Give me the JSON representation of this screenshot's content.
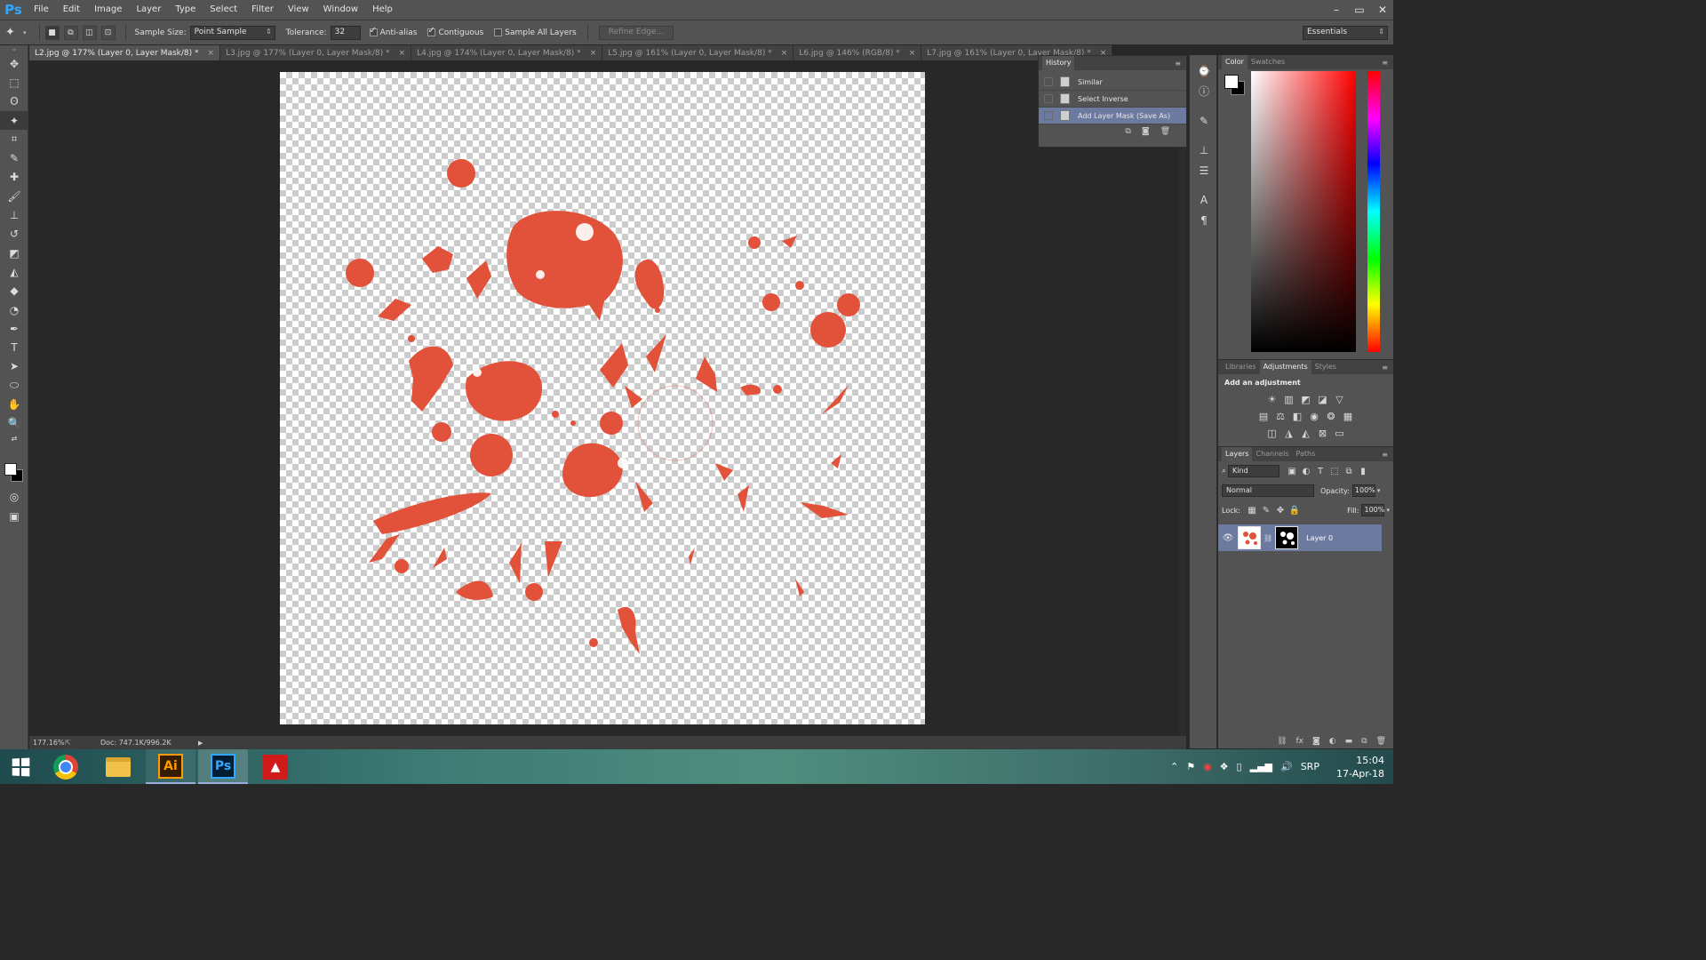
{
  "app": {
    "logo": "Ps"
  },
  "menu": [
    "File",
    "Edit",
    "Image",
    "Layer",
    "Type",
    "Select",
    "Filter",
    "View",
    "Window",
    "Help"
  ],
  "window_controls": {
    "minimize": "–",
    "restore": "▭",
    "close": "✕"
  },
  "options": {
    "sample_size_label": "Sample Size:",
    "sample_size_value": "Point Sample",
    "tolerance_label": "Tolerance:",
    "tolerance_value": "32",
    "anti_alias": "Anti-alias",
    "contiguous": "Contiguous",
    "sample_all_layers": "Sample All Layers",
    "refine_edge": "Refine Edge...",
    "workspace": "Essentials"
  },
  "doc_tabs": [
    {
      "label": "L2.jpg @ 177% (Layer 0, Layer Mask/8) *",
      "active": true
    },
    {
      "label": "L3.jpg @ 177% (Layer 0, Layer Mask/8) *",
      "active": false
    },
    {
      "label": "L4.jpg @ 174% (Layer 0, Layer Mask/8) *",
      "active": false
    },
    {
      "label": "L5.jpg @ 161% (Layer 0, Layer Mask/8) *",
      "active": false
    },
    {
      "label": "L6.jpg @ 146% (RGB/8) *",
      "active": false
    },
    {
      "label": "L7.jpg @ 161% (Layer 0, Layer Mask/8) *",
      "active": false
    }
  ],
  "status": {
    "zoom": "177.16%",
    "doc": "Doc: 747.1K/996.2K"
  },
  "history": {
    "title": "History",
    "items": [
      {
        "label": "Similar",
        "selected": false
      },
      {
        "label": "Select Inverse",
        "selected": false
      },
      {
        "label": "Add Layer Mask (Save As)",
        "selected": true
      }
    ]
  },
  "color_panel": {
    "tabs": [
      "Color",
      "Swatches"
    ]
  },
  "adjustments": {
    "tabs": [
      "Libraries",
      "Adjustments",
      "Styles"
    ],
    "title": "Add an adjustment"
  },
  "layers": {
    "tabs": [
      "Layers",
      "Channels",
      "Paths"
    ],
    "filter": "Kind",
    "blend_mode": "Normal",
    "opacity_label": "Opacity:",
    "opacity_value": "100%",
    "lock_label": "Lock:",
    "fill_label": "Fill:",
    "fill_value": "100%",
    "layer_name": "Layer 0"
  },
  "taskbar": {
    "ai_label": "Ai",
    "ps_label": "Ps",
    "language": "SRP",
    "time": "15:04",
    "date": "17-Apr-18"
  },
  "colors": {
    "splatter": "#e2513a",
    "selection": "#6d7aa0",
    "ps_blue": "#31a8ff"
  }
}
